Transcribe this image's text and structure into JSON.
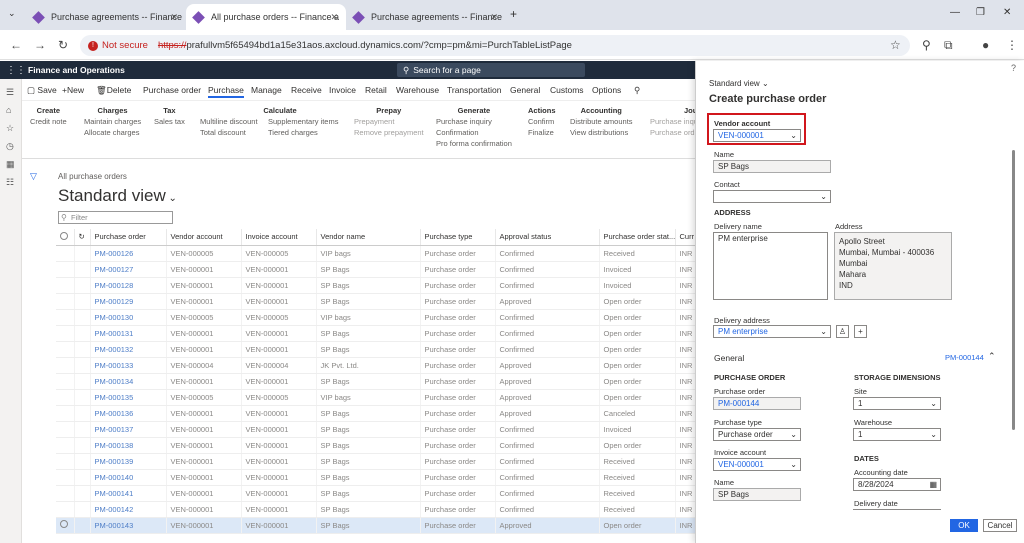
{
  "browser": {
    "tabs": [
      {
        "title": "Purchase agreements -- Finance"
      },
      {
        "title": "All purchase orders -- Finance a"
      },
      {
        "title": "Purchase agreements -- Finance"
      }
    ],
    "new_tab": "+",
    "security": "Not secure",
    "url_scheme": "https://",
    "url_rest": "prafullvm5f65494bd1a15e31aos.axcloud.dynamics.com/?cmp=pm&mi=PurchTableListPage"
  },
  "app": {
    "title": "Finance and Operations",
    "search_placeholder": "Search for a page",
    "help": "?"
  },
  "actions": {
    "save": "Save",
    "new": "New",
    "delete": "Delete",
    "tabs": [
      "Purchase order",
      "Purchase",
      "Manage",
      "Receive",
      "Invoice",
      "Retail",
      "Warehouse",
      "Transportation",
      "General",
      "Customs",
      "Options"
    ]
  },
  "ribbon": {
    "create": {
      "h": "Create",
      "items": [
        "Credit note"
      ]
    },
    "charges": {
      "h": "Charges",
      "items": [
        "Maintain charges",
        "Allocate charges"
      ]
    },
    "tax": {
      "h": "Tax",
      "items": [
        "Sales tax"
      ]
    },
    "calculate": {
      "h": "Calculate",
      "items": [
        "Multiline discount",
        "Total discount",
        "Supplementary items",
        "Tiered charges"
      ]
    },
    "prepay": {
      "h": "Prepay",
      "items": [
        "Prepayment",
        "Remove prepayment"
      ]
    },
    "generate": {
      "h": "Generate",
      "items": [
        "Purchase inquiry",
        "Confirmation",
        "Pro forma confirmation"
      ]
    },
    "actions": {
      "h": "Actions",
      "items": [
        "Confirm",
        "Finalize"
      ]
    },
    "accounting": {
      "h": "Accounting",
      "items": [
        "Distribute amounts",
        "View distributions"
      ]
    },
    "journals": {
      "h": "Jou",
      "items": [
        "Purchase inqu",
        "Purchase ord"
      ]
    }
  },
  "list": {
    "breadcrumb": "All purchase orders",
    "view_title": "Standard view",
    "filter_placeholder": "Filter",
    "columns": [
      "Purchase order",
      "Vendor account",
      "Invoice account",
      "Vendor name",
      "Purchase type",
      "Approval status",
      "Purchase order stat...",
      "Curr"
    ],
    "rows": [
      [
        "PM-000126",
        "VEN-000005",
        "VEN-000005",
        "VIP bags",
        "Purchase order",
        "Confirmed",
        "Received",
        "INR"
      ],
      [
        "PM-000127",
        "VEN-000001",
        "VEN-000001",
        "SP Bags",
        "Purchase order",
        "Confirmed",
        "Invoiced",
        "INR"
      ],
      [
        "PM-000128",
        "VEN-000001",
        "VEN-000001",
        "SP Bags",
        "Purchase order",
        "Confirmed",
        "Invoiced",
        "INR"
      ],
      [
        "PM-000129",
        "VEN-000001",
        "VEN-000001",
        "SP Bags",
        "Purchase order",
        "Approved",
        "Open order",
        "INR"
      ],
      [
        "PM-000130",
        "VEN-000005",
        "VEN-000005",
        "VIP bags",
        "Purchase order",
        "Confirmed",
        "Open order",
        "INR"
      ],
      [
        "PM-000131",
        "VEN-000001",
        "VEN-000001",
        "SP Bags",
        "Purchase order",
        "Confirmed",
        "Open order",
        "INR"
      ],
      [
        "PM-000132",
        "VEN-000001",
        "VEN-000001",
        "SP Bags",
        "Purchase order",
        "Confirmed",
        "Open order",
        "INR"
      ],
      [
        "PM-000133",
        "VEN-000004",
        "VEN-000004",
        "JK Pvt. Ltd.",
        "Purchase order",
        "Approved",
        "Open order",
        "INR"
      ],
      [
        "PM-000134",
        "VEN-000001",
        "VEN-000001",
        "SP Bags",
        "Purchase order",
        "Approved",
        "Open order",
        "INR"
      ],
      [
        "PM-000135",
        "VEN-000005",
        "VEN-000005",
        "VIP bags",
        "Purchase order",
        "Approved",
        "Open order",
        "INR"
      ],
      [
        "PM-000136",
        "VEN-000001",
        "VEN-000001",
        "SP Bags",
        "Purchase order",
        "Approved",
        "Canceled",
        "INR"
      ],
      [
        "PM-000137",
        "VEN-000001",
        "VEN-000001",
        "SP Bags",
        "Purchase order",
        "Confirmed",
        "Invoiced",
        "INR"
      ],
      [
        "PM-000138",
        "VEN-000001",
        "VEN-000001",
        "SP Bags",
        "Purchase order",
        "Confirmed",
        "Open order",
        "INR"
      ],
      [
        "PM-000139",
        "VEN-000001",
        "VEN-000001",
        "SP Bags",
        "Purchase order",
        "Confirmed",
        "Received",
        "INR"
      ],
      [
        "PM-000140",
        "VEN-000001",
        "VEN-000001",
        "SP Bags",
        "Purchase order",
        "Confirmed",
        "Received",
        "INR"
      ],
      [
        "PM-000141",
        "VEN-000001",
        "VEN-000001",
        "SP Bags",
        "Purchase order",
        "Confirmed",
        "Received",
        "INR"
      ],
      [
        "PM-000142",
        "VEN-000001",
        "VEN-000001",
        "SP Bags",
        "Purchase order",
        "Confirmed",
        "Received",
        "INR"
      ],
      [
        "PM-000143",
        "VEN-000001",
        "VEN-000001",
        "SP Bags",
        "Purchase order",
        "Approved",
        "Open order",
        "INR"
      ]
    ]
  },
  "panel": {
    "view": "Standard view",
    "title": "Create purchase order",
    "vendor_account_label": "Vendor account",
    "vendor_account": "VEN-000001",
    "name_label": "Name",
    "name": "SP Bags",
    "contact_label": "Contact",
    "address_section": "ADDRESS",
    "delivery_name_label": "Delivery name",
    "delivery_name": "PM enterprise",
    "address_label": "Address",
    "address_lines": [
      "Apollo Street",
      "Mumbai, Mumbai - 400036",
      "Mumbai",
      "Mahara",
      "IND"
    ],
    "delivery_address_label": "Delivery address",
    "delivery_address": "PM enterprise",
    "general_label": "General",
    "general_summary": "PM-000144",
    "po_section": "PURCHASE ORDER",
    "po_label": "Purchase order",
    "po_value": "PM-000144",
    "ptype_label": "Purchase type",
    "ptype_value": "Purchase order",
    "inv_label": "Invoice account",
    "inv_value": "VEN-000001",
    "name2_label": "Name",
    "name2_value": "SP Bags",
    "storage_section": "STORAGE DIMENSIONS",
    "site_label": "Site",
    "site_value": "1",
    "wh_label": "Warehouse",
    "wh_value": "1",
    "dates_section": "DATES",
    "acc_date_label": "Accounting date",
    "acc_date_value": "8/28/2024",
    "del_date_label": "Delivery date",
    "ok": "OK",
    "cancel": "Cancel"
  }
}
